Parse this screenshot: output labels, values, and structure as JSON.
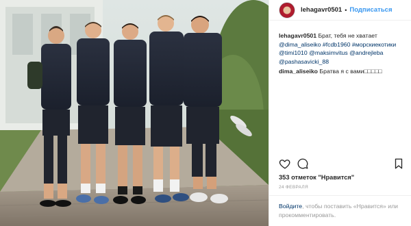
{
  "header": {
    "username": "lehagavr0501",
    "separator": "•",
    "follow_label": "Подписаться"
  },
  "caption": {
    "username": "lehagavr0501",
    "text_prefix": "Брат, тебя не хватает",
    "line2": {
      "mention1": "@dima_aliseiko",
      "hashtag1": "#fcdb1960",
      "hashtag2": "#морскиекотики"
    },
    "line3": {
      "mention1": "@timi1010",
      "mention2": "@maksimvitus",
      "mention3": "@andrejleba"
    },
    "line4": {
      "mention1": "@pashasavicki_88"
    }
  },
  "reply": {
    "username": "dima_aliseiko",
    "text": "Братва я с вами□□□□□"
  },
  "actions": {
    "like_icon": "heart-outline-icon",
    "comment_icon": "speech-bubble-icon",
    "save_icon": "bookmark-icon"
  },
  "likes": {
    "count_text": "353 отметок \"Нравится\""
  },
  "date": {
    "text": "24 ФЕВРАЛЯ"
  },
  "login": {
    "link_text": "Войдите",
    "rest_text": ", чтобы поставить «Нравится» или прокомментировать."
  },
  "colors": {
    "link_blue": "#3897f0",
    "tag_blue": "#003569",
    "muted_gray": "#999999",
    "text_dark": "#262626"
  },
  "photo": {
    "subject": "five-footballers-in-training-kit-photo"
  }
}
